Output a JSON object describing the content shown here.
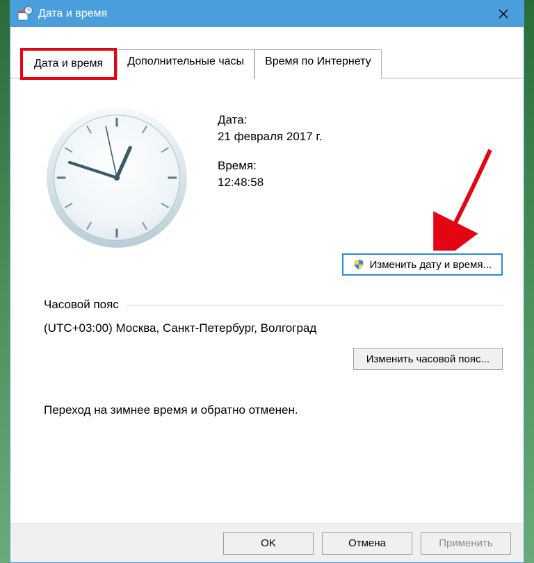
{
  "window": {
    "title": "Дата и время"
  },
  "tabs": {
    "t0": "Дата и время",
    "t1": "Дополнительные часы",
    "t2": "Время по Интернету"
  },
  "dateLabel": "Дата:",
  "dateValue": "21 февраля 2017 г.",
  "timeLabel": "Время:",
  "timeValue": "12:48:58",
  "changeDateTimeBtn": "Изменить дату и время...",
  "tzHeader": "Часовой пояс",
  "tzValue": "(UTC+03:00) Москва, Санкт-Петербург, Волгоград",
  "changeTzBtn": "Изменить часовой пояс...",
  "dstNote": "Переход на зимнее время и обратно отменен.",
  "footer": {
    "ok": "OK",
    "cancel": "Отмена",
    "apply": "Применить"
  },
  "clock": {
    "hour": 12,
    "minute": 48,
    "second": 58
  }
}
